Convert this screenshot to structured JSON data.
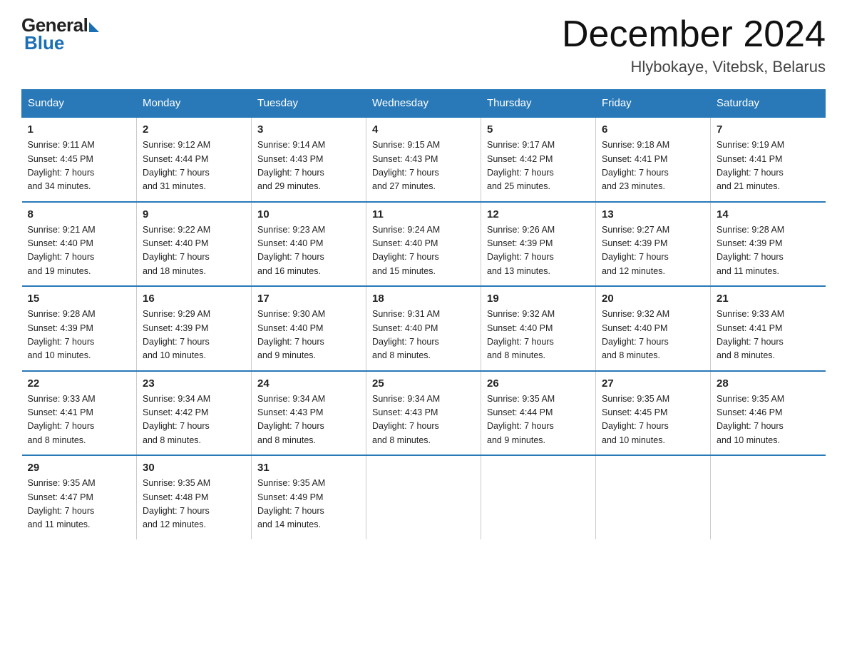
{
  "header": {
    "logo_general": "General",
    "logo_blue": "Blue",
    "month_title": "December 2024",
    "location": "Hlybokaye, Vitebsk, Belarus"
  },
  "days_of_week": [
    "Sunday",
    "Monday",
    "Tuesday",
    "Wednesday",
    "Thursday",
    "Friday",
    "Saturday"
  ],
  "weeks": [
    [
      {
        "day": "1",
        "info": "Sunrise: 9:11 AM\nSunset: 4:45 PM\nDaylight: 7 hours\nand 34 minutes."
      },
      {
        "day": "2",
        "info": "Sunrise: 9:12 AM\nSunset: 4:44 PM\nDaylight: 7 hours\nand 31 minutes."
      },
      {
        "day": "3",
        "info": "Sunrise: 9:14 AM\nSunset: 4:43 PM\nDaylight: 7 hours\nand 29 minutes."
      },
      {
        "day": "4",
        "info": "Sunrise: 9:15 AM\nSunset: 4:43 PM\nDaylight: 7 hours\nand 27 minutes."
      },
      {
        "day": "5",
        "info": "Sunrise: 9:17 AM\nSunset: 4:42 PM\nDaylight: 7 hours\nand 25 minutes."
      },
      {
        "day": "6",
        "info": "Sunrise: 9:18 AM\nSunset: 4:41 PM\nDaylight: 7 hours\nand 23 minutes."
      },
      {
        "day": "7",
        "info": "Sunrise: 9:19 AM\nSunset: 4:41 PM\nDaylight: 7 hours\nand 21 minutes."
      }
    ],
    [
      {
        "day": "8",
        "info": "Sunrise: 9:21 AM\nSunset: 4:40 PM\nDaylight: 7 hours\nand 19 minutes."
      },
      {
        "day": "9",
        "info": "Sunrise: 9:22 AM\nSunset: 4:40 PM\nDaylight: 7 hours\nand 18 minutes."
      },
      {
        "day": "10",
        "info": "Sunrise: 9:23 AM\nSunset: 4:40 PM\nDaylight: 7 hours\nand 16 minutes."
      },
      {
        "day": "11",
        "info": "Sunrise: 9:24 AM\nSunset: 4:40 PM\nDaylight: 7 hours\nand 15 minutes."
      },
      {
        "day": "12",
        "info": "Sunrise: 9:26 AM\nSunset: 4:39 PM\nDaylight: 7 hours\nand 13 minutes."
      },
      {
        "day": "13",
        "info": "Sunrise: 9:27 AM\nSunset: 4:39 PM\nDaylight: 7 hours\nand 12 minutes."
      },
      {
        "day": "14",
        "info": "Sunrise: 9:28 AM\nSunset: 4:39 PM\nDaylight: 7 hours\nand 11 minutes."
      }
    ],
    [
      {
        "day": "15",
        "info": "Sunrise: 9:28 AM\nSunset: 4:39 PM\nDaylight: 7 hours\nand 10 minutes."
      },
      {
        "day": "16",
        "info": "Sunrise: 9:29 AM\nSunset: 4:39 PM\nDaylight: 7 hours\nand 10 minutes."
      },
      {
        "day": "17",
        "info": "Sunrise: 9:30 AM\nSunset: 4:40 PM\nDaylight: 7 hours\nand 9 minutes."
      },
      {
        "day": "18",
        "info": "Sunrise: 9:31 AM\nSunset: 4:40 PM\nDaylight: 7 hours\nand 8 minutes."
      },
      {
        "day": "19",
        "info": "Sunrise: 9:32 AM\nSunset: 4:40 PM\nDaylight: 7 hours\nand 8 minutes."
      },
      {
        "day": "20",
        "info": "Sunrise: 9:32 AM\nSunset: 4:40 PM\nDaylight: 7 hours\nand 8 minutes."
      },
      {
        "day": "21",
        "info": "Sunrise: 9:33 AM\nSunset: 4:41 PM\nDaylight: 7 hours\nand 8 minutes."
      }
    ],
    [
      {
        "day": "22",
        "info": "Sunrise: 9:33 AM\nSunset: 4:41 PM\nDaylight: 7 hours\nand 8 minutes."
      },
      {
        "day": "23",
        "info": "Sunrise: 9:34 AM\nSunset: 4:42 PM\nDaylight: 7 hours\nand 8 minutes."
      },
      {
        "day": "24",
        "info": "Sunrise: 9:34 AM\nSunset: 4:43 PM\nDaylight: 7 hours\nand 8 minutes."
      },
      {
        "day": "25",
        "info": "Sunrise: 9:34 AM\nSunset: 4:43 PM\nDaylight: 7 hours\nand 8 minutes."
      },
      {
        "day": "26",
        "info": "Sunrise: 9:35 AM\nSunset: 4:44 PM\nDaylight: 7 hours\nand 9 minutes."
      },
      {
        "day": "27",
        "info": "Sunrise: 9:35 AM\nSunset: 4:45 PM\nDaylight: 7 hours\nand 10 minutes."
      },
      {
        "day": "28",
        "info": "Sunrise: 9:35 AM\nSunset: 4:46 PM\nDaylight: 7 hours\nand 10 minutes."
      }
    ],
    [
      {
        "day": "29",
        "info": "Sunrise: 9:35 AM\nSunset: 4:47 PM\nDaylight: 7 hours\nand 11 minutes."
      },
      {
        "day": "30",
        "info": "Sunrise: 9:35 AM\nSunset: 4:48 PM\nDaylight: 7 hours\nand 12 minutes."
      },
      {
        "day": "31",
        "info": "Sunrise: 9:35 AM\nSunset: 4:49 PM\nDaylight: 7 hours\nand 14 minutes."
      },
      {
        "day": "",
        "info": ""
      },
      {
        "day": "",
        "info": ""
      },
      {
        "day": "",
        "info": ""
      },
      {
        "day": "",
        "info": ""
      }
    ]
  ]
}
